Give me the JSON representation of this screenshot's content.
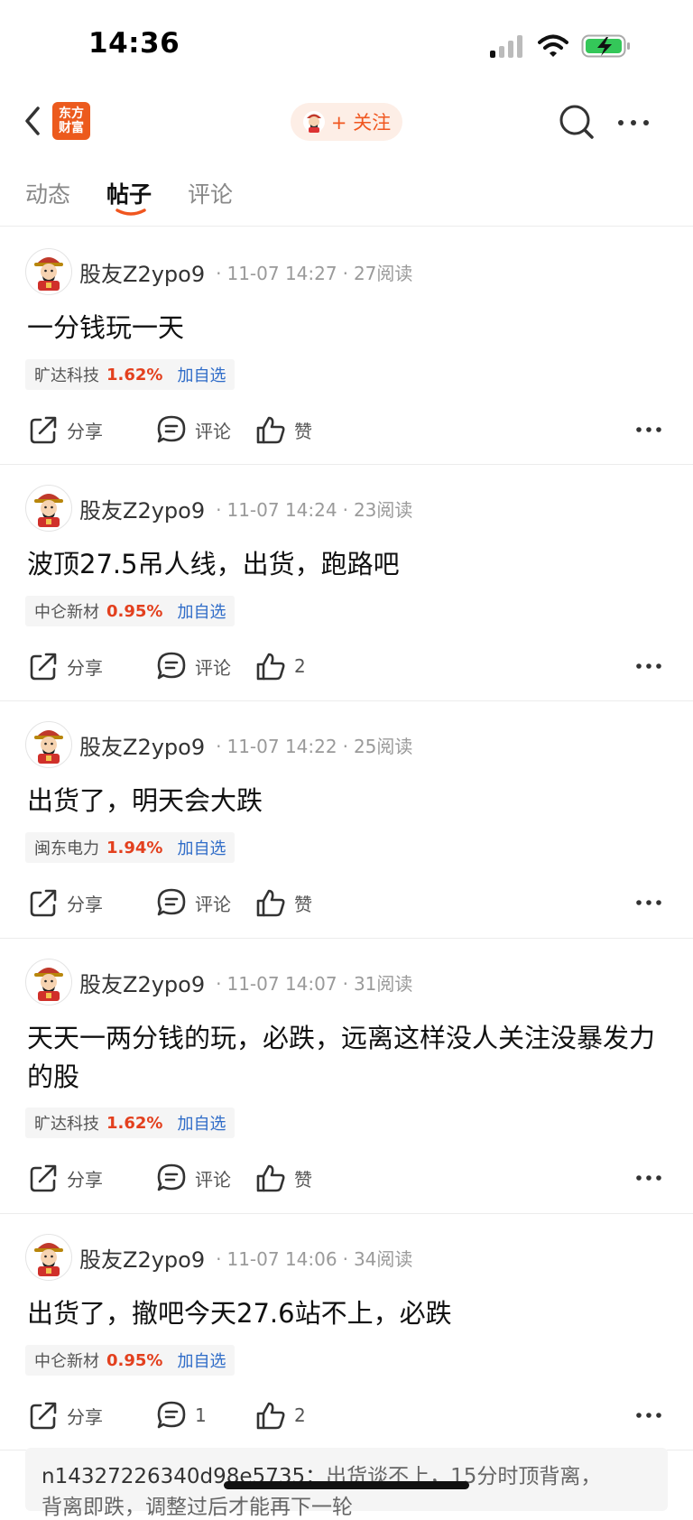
{
  "status_bar": {
    "time": "14:36"
  },
  "nav": {
    "logo_line1": "东方",
    "logo_line2": "财富",
    "follow_label": "+ 关注"
  },
  "tabs": [
    {
      "label": "动态",
      "active": false
    },
    {
      "label": "帖子",
      "active": true
    },
    {
      "label": "评论",
      "active": false
    }
  ],
  "posts": [
    {
      "author": "股友Z2ypo9",
      "time": "11-07 14:27",
      "reads": "27阅读",
      "text": "一分钱玩一天",
      "stock": {
        "name": "旷达科技",
        "change": "1.62%",
        "watch": "加自选"
      },
      "share": "分享",
      "comment": "评论",
      "like": "赞"
    },
    {
      "author": "股友Z2ypo9",
      "time": "11-07 14:24",
      "reads": "23阅读",
      "text": "波顶27.5吊人线，出货，跑路吧",
      "stock": {
        "name": "中仑新材",
        "change": "0.95%",
        "watch": "加自选"
      },
      "share": "分享",
      "comment": "评论",
      "like": "2"
    },
    {
      "author": "股友Z2ypo9",
      "time": "11-07 14:22",
      "reads": "25阅读",
      "text": "出货了，明天会大跌",
      "stock": {
        "name": "闽东电力",
        "change": "1.94%",
        "watch": "加自选"
      },
      "share": "分享",
      "comment": "评论",
      "like": "赞"
    },
    {
      "author": "股友Z2ypo9",
      "time": "11-07 14:07",
      "reads": "31阅读",
      "text": "天天一两分钱的玩，必跌，远离这样没人关注没暴发力的股",
      "stock": {
        "name": "旷达科技",
        "change": "1.62%",
        "watch": "加自选"
      },
      "share": "分享",
      "comment": "评论",
      "like": "赞"
    },
    {
      "author": "股友Z2ypo9",
      "time": "11-07 14:06",
      "reads": "34阅读",
      "text": "出货了，撤吧今天27.6站不上，必跌",
      "stock": {
        "name": "中仑新材",
        "change": "0.95%",
        "watch": "加自选"
      },
      "share": "分享",
      "comment": "1",
      "like": "2"
    }
  ],
  "comment_preview": {
    "user": "n14327226340d98e5735：",
    "line1": "出货谈不上，15分时顶背离，",
    "line2": "背离即跌，调整过后才能再下一轮"
  },
  "colors": {
    "brand": "#ec5a1d",
    "up": "#e3401e",
    "link": "#2f6cc8"
  },
  "icons": [
    "back-arrow-icon",
    "search-icon",
    "more-icon",
    "share-icon",
    "comment-icon",
    "like-icon"
  ]
}
